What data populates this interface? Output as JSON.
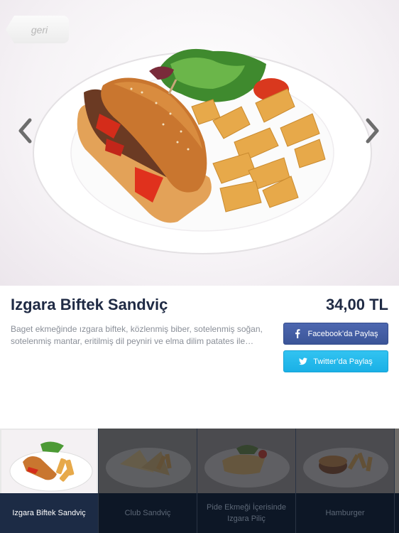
{
  "nav": {
    "back_label": "geri"
  },
  "product": {
    "title": "Izgara Biftek Sandviç",
    "price": "34,00 TL",
    "description": "Baget ekmeğinde ızgara biftek, közlenmiş biber, sotelenmiş soğan, sotelenmiş mantar, eritilmiş dil peyniri ve elma dilim patates ile…"
  },
  "share": {
    "facebook_label": "Facebook’da Paylaş",
    "twitter_label": "Twitter’da Paylaş"
  },
  "thumbnails": [
    {
      "label": "Izgara Biftek Sandviç",
      "active": true
    },
    {
      "label": "Club Sandviç",
      "active": false
    },
    {
      "label": "Pide Ekmeği İçerisinde Izgara Piliç",
      "active": false
    },
    {
      "label": "Hamburger",
      "active": false
    }
  ],
  "colors": {
    "title": "#1f2a44",
    "facebook": "#3b5598",
    "twitter": "#1ab0e6",
    "thumb_bar": "#0f1a2a"
  },
  "icons": [
    "chevron-left-icon",
    "chevron-right-icon",
    "facebook-icon",
    "twitter-icon"
  ]
}
